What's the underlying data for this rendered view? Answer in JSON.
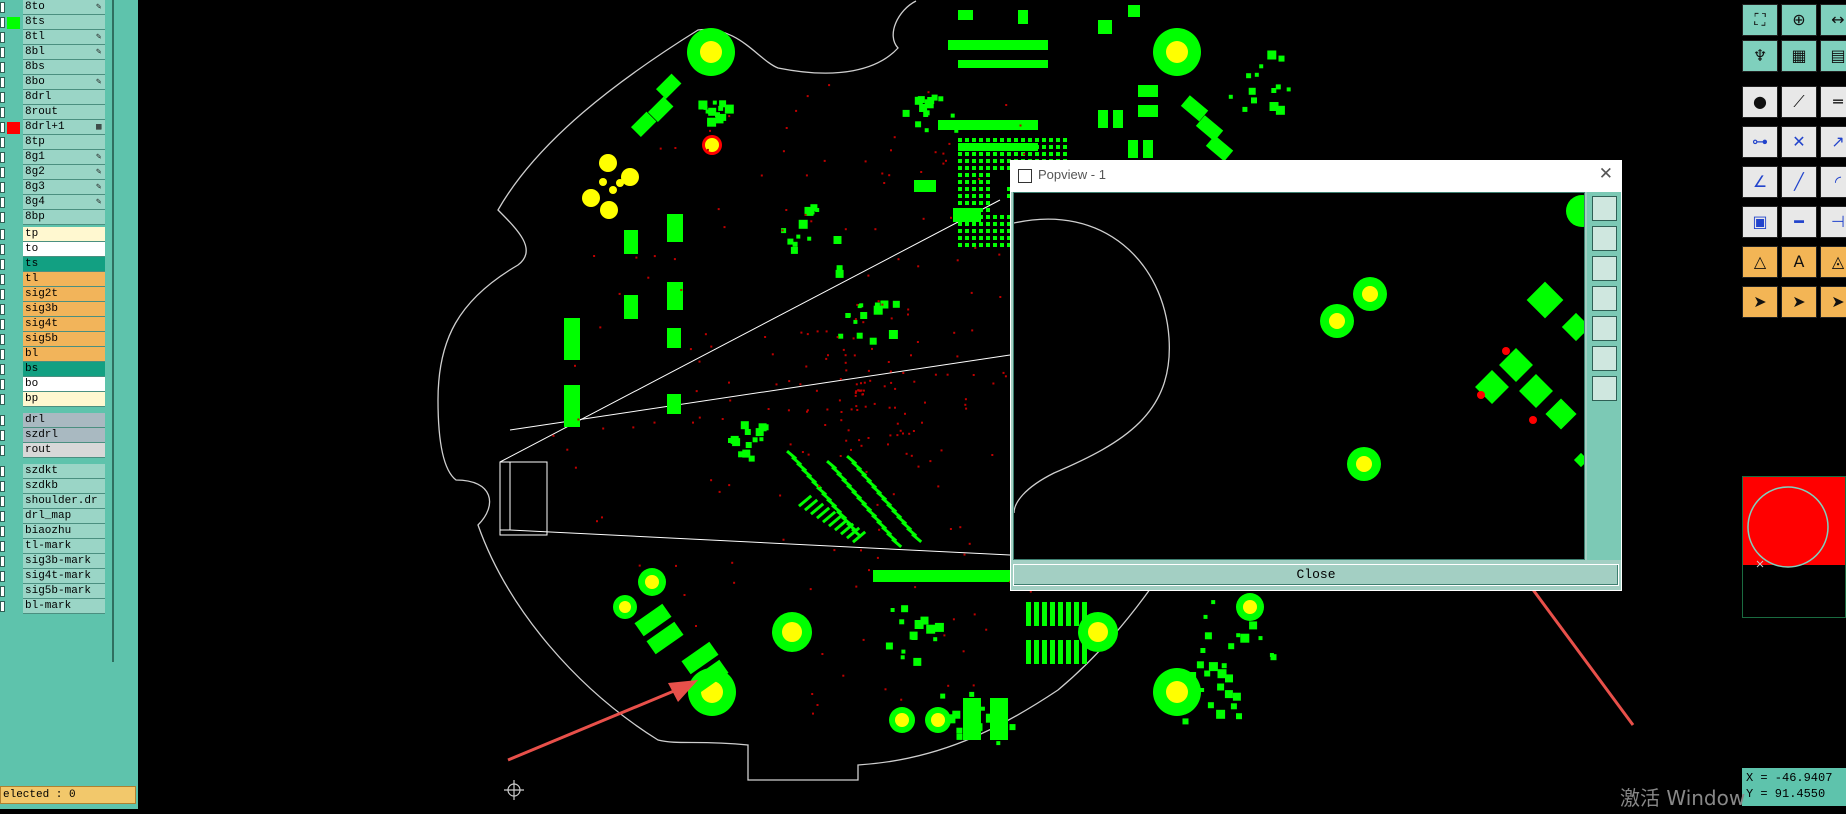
{
  "layers": {
    "groups": [
      {
        "id": "g1",
        "items": [
          {
            "name": "8to",
            "mark": "✎",
            "swatch": "none",
            "bg": "#9ad5c6"
          },
          {
            "name": "8ts",
            "mark": "",
            "swatch": "#00ff00",
            "bg": "#9ad5c6"
          },
          {
            "name": "8tl",
            "mark": "✎",
            "swatch": "none",
            "bg": "#9ad5c6"
          },
          {
            "name": "8bl",
            "mark": "✎",
            "swatch": "none",
            "bg": "#9ad5c6"
          },
          {
            "name": "8bs",
            "mark": "",
            "swatch": "none",
            "bg": "#9ad5c6"
          },
          {
            "name": "8bo",
            "mark": "✎",
            "swatch": "none",
            "bg": "#9ad5c6"
          },
          {
            "name": "8drl",
            "mark": "",
            "swatch": "none",
            "bg": "#9ad5c6"
          },
          {
            "name": "8rout",
            "mark": "",
            "swatch": "none",
            "bg": "#9ad5c6"
          },
          {
            "name": "8drl+1",
            "mark": "▦",
            "swatch": "#ff0000",
            "bg": "#9ad5c6"
          },
          {
            "name": "8tp",
            "mark": "",
            "swatch": "none",
            "bg": "#9ad5c6"
          },
          {
            "name": "8g1",
            "mark": "✎",
            "swatch": "none",
            "bg": "#9ad5c6"
          },
          {
            "name": "8g2",
            "mark": "✎",
            "swatch": "none",
            "bg": "#9ad5c6"
          },
          {
            "name": "8g3",
            "mark": "✎",
            "swatch": "none",
            "bg": "#9ad5c6"
          },
          {
            "name": "8g4",
            "mark": "✎",
            "swatch": "none",
            "bg": "#9ad5c6"
          },
          {
            "name": "8bp",
            "mark": "",
            "swatch": "none",
            "bg": "#9ad5c6"
          }
        ]
      },
      {
        "id": "g2",
        "items": [
          {
            "name": "tp",
            "mark": "",
            "swatch": "none",
            "bg": "#fff8d0"
          },
          {
            "name": "to",
            "mark": "",
            "swatch": "none",
            "bg": "#ffffff"
          },
          {
            "name": "ts",
            "mark": "",
            "swatch": "none",
            "bg": "#12a082"
          },
          {
            "name": "tl",
            "mark": "",
            "swatch": "none",
            "bg": "#f2b45a"
          },
          {
            "name": "sig2t",
            "mark": "",
            "swatch": "none",
            "bg": "#f2b45a"
          },
          {
            "name": "sig3b",
            "mark": "",
            "swatch": "none",
            "bg": "#f2b45a"
          },
          {
            "name": "sig4t",
            "mark": "",
            "swatch": "none",
            "bg": "#f2b45a"
          },
          {
            "name": "sig5b",
            "mark": "",
            "swatch": "none",
            "bg": "#f2b45a"
          },
          {
            "name": "bl",
            "mark": "",
            "swatch": "none",
            "bg": "#f2b45a"
          },
          {
            "name": "bs",
            "mark": "",
            "swatch": "none",
            "bg": "#12a082"
          },
          {
            "name": "bo",
            "mark": "",
            "swatch": "none",
            "bg": "#ffffff"
          },
          {
            "name": "bp",
            "mark": "",
            "swatch": "none",
            "bg": "#fff8d0"
          }
        ]
      },
      {
        "id": "g3",
        "items": [
          {
            "name": "drl",
            "mark": "",
            "swatch": "none",
            "bg": "#a9b9c1"
          },
          {
            "name": "szdrl",
            "mark": "",
            "swatch": "none",
            "bg": "#a9b9c1"
          },
          {
            "name": "rout",
            "mark": "",
            "swatch": "none",
            "bg": "#d8d8d8"
          }
        ]
      },
      {
        "id": "g4",
        "items": [
          {
            "name": "szdkt",
            "mark": "",
            "swatch": "none",
            "bg": "#9ad5c6"
          },
          {
            "name": "szdkb",
            "mark": "",
            "swatch": "none",
            "bg": "#9ad5c6"
          },
          {
            "name": "shoulder.dr",
            "mark": "",
            "swatch": "none",
            "bg": "#9ad5c6"
          },
          {
            "name": "drl_map",
            "mark": "",
            "swatch": "none",
            "bg": "#9ad5c6"
          },
          {
            "name": "biaozhu",
            "mark": "",
            "swatch": "none",
            "bg": "#9ad5c6"
          },
          {
            "name": "tl-mark",
            "mark": "",
            "swatch": "none",
            "bg": "#9ad5c6"
          },
          {
            "name": "sig3b-mark",
            "mark": "",
            "swatch": "none",
            "bg": "#9ad5c6"
          },
          {
            "name": "sig4t-mark",
            "mark": "",
            "swatch": "none",
            "bg": "#9ad5c6"
          },
          {
            "name": "sig5b-mark",
            "mark": "",
            "swatch": "none",
            "bg": "#9ad5c6"
          },
          {
            "name": "bl-mark",
            "mark": "",
            "swatch": "none",
            "bg": "#9ad5c6"
          }
        ]
      }
    ]
  },
  "status": {
    "selected": "elected : 0"
  },
  "popview": {
    "title": "Popview - 1",
    "close_label": "Close",
    "close_x": "✕"
  },
  "coords": {
    "x": "X = -46.9407",
    "y": "Y = 91.4550"
  },
  "watermark": "激活 Window",
  "colors": {
    "pad_green": "#00ff00",
    "pad_yellow": "#ffff00",
    "arrow": "#e8504a",
    "board_outline": "#cccccc",
    "panel_teal": "#5ec3ac"
  },
  "icons": {
    "right_toolbar": [
      "zoom-fit-icon",
      "zoom-window-icon",
      "zoom-ratio-icon",
      "route-icon",
      "grid-icon",
      "select-layer-icon",
      "display-mode-icon",
      "draw-polyline-icon",
      "ruler-icon",
      "connect-nodes-icon",
      "delete-cross-icon",
      "move-node-icon",
      "measure-angle-icon",
      "draw-line-icon",
      "arc-icon",
      "place-pad-icon",
      "dimension-icon",
      "split-icon",
      "triangle-icon",
      "font-text-icon",
      "triangle-outline-icon",
      "pointer-icon",
      "pointer-select-icon",
      "pointer-alt-icon"
    ]
  }
}
